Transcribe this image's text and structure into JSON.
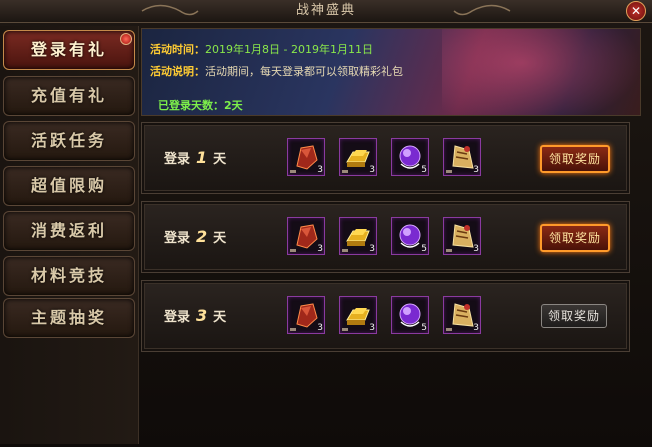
{
  "window": {
    "title": "战神盛典",
    "close": "✕"
  },
  "menu": {
    "items": [
      {
        "label": "登录有礼",
        "active": true
      },
      {
        "label": "充值有礼"
      },
      {
        "label": "活跃任务"
      },
      {
        "label": "超值限购"
      },
      {
        "label": "消费返利"
      },
      {
        "label": "材料竞技"
      },
      {
        "label": "主题抽奖"
      }
    ]
  },
  "banner": {
    "time_label": "活动时间：",
    "time_value": "2019年1月8日 - 2019年1月11日",
    "desc_label": "活动说明：",
    "desc_value": "活动期间，每天登录都可以领取精彩礼包",
    "days_label": "已登录天数：",
    "days_value": "2天"
  },
  "rows": [
    {
      "prefix": "登录",
      "day": "1",
      "suffix": "天",
      "items": [
        {
          "icon": "red-stone-icon",
          "qty": "3"
        },
        {
          "icon": "gold-bar-icon",
          "qty": "3"
        },
        {
          "icon": "purple-orb-icon",
          "qty": "5"
        },
        {
          "icon": "scroll-pouch-icon",
          "qty": "3"
        }
      ],
      "button": "领取奖励",
      "button_state": "enabled"
    },
    {
      "prefix": "登录",
      "day": "2",
      "suffix": "天",
      "items": [
        {
          "icon": "red-stone-icon",
          "qty": "3"
        },
        {
          "icon": "gold-bar-icon",
          "qty": "3"
        },
        {
          "icon": "purple-orb-icon",
          "qty": "5"
        },
        {
          "icon": "scroll-pouch-icon",
          "qty": "3"
        }
      ],
      "button": "领取奖励",
      "button_state": "enabled"
    },
    {
      "prefix": "登录",
      "day": "3",
      "suffix": "天",
      "items": [
        {
          "icon": "red-stone-icon",
          "qty": "3"
        },
        {
          "icon": "gold-bar-icon",
          "qty": "3"
        },
        {
          "icon": "purple-orb-icon",
          "qty": "5"
        },
        {
          "icon": "scroll-pouch-icon",
          "qty": "3"
        }
      ],
      "button": "领取奖励",
      "button_state": "disabled"
    }
  ],
  "colors": {
    "accent": "#ffcc33",
    "highlight": "#ff9a2a",
    "days": "#7df04a"
  }
}
